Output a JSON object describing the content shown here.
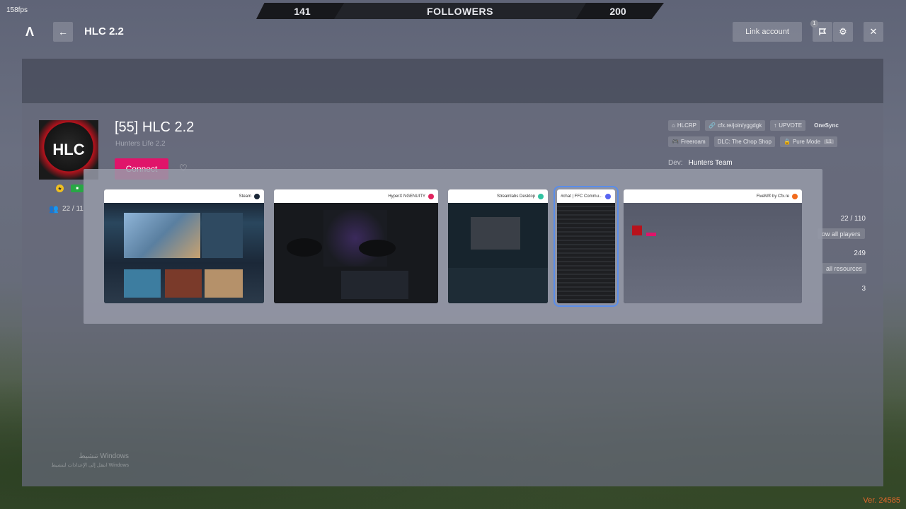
{
  "overlay": {
    "fps": "158fps",
    "version": "Ver. 24585"
  },
  "followers": {
    "left": "141",
    "label": "FOLLOWERS",
    "right": "200"
  },
  "topbar": {
    "logo": "Λ",
    "back_icon": "arrow-left-icon",
    "title": "HLC 2.2",
    "link_account": "Link account",
    "notification_count": "1",
    "icons": [
      "flag-icon",
      "gear-icon",
      "close-icon"
    ]
  },
  "server": {
    "logo_text": "HLC",
    "name": "[55] HLC 2.2",
    "subtitle": "Hunters Life 2.2",
    "connect_label": "Connect",
    "players_partial": "22 / 11",
    "tags": [
      {
        "icon": "home-icon",
        "label": "HLCRP"
      },
      {
        "icon": "link-icon",
        "label": "cfx.re/join/yggdgk"
      },
      {
        "icon": "arrow-up-icon",
        "label": "UPVOTE"
      },
      {
        "icon": "",
        "label": "OneSync"
      },
      {
        "icon": "gamepad-icon",
        "label": "Freeroam"
      },
      {
        "icon": "",
        "label": "DLC: The Chop Shop"
      },
      {
        "icon": "lock-icon",
        "label": "Pure Mode",
        "key": "L1"
      }
    ],
    "dev_label": "Dev:",
    "dev_value": "Hunters Team",
    "players_value": "22 / 110",
    "show_players": "ow all players",
    "resources_value": "249",
    "show_resources": "all resources",
    "third_value": "3"
  },
  "switcher": {
    "windows": [
      {
        "title": "Steam",
        "color": "#1b2838"
      },
      {
        "title": "HyperX NGENUITY",
        "color": "#e0245e"
      },
      {
        "title": "Streamlabs Desktop",
        "color": "#31c3a2"
      },
      {
        "title": "#chat | FFC Commu...",
        "color": "#5865f2"
      },
      {
        "title": "FiveM® by Cfx.re",
        "color": "#f26b1d"
      }
    ]
  },
  "watermark": {
    "line1": "تنشيط Windows",
    "line2": "انتقل إلى الإعدادات لتنشيط Windows"
  }
}
